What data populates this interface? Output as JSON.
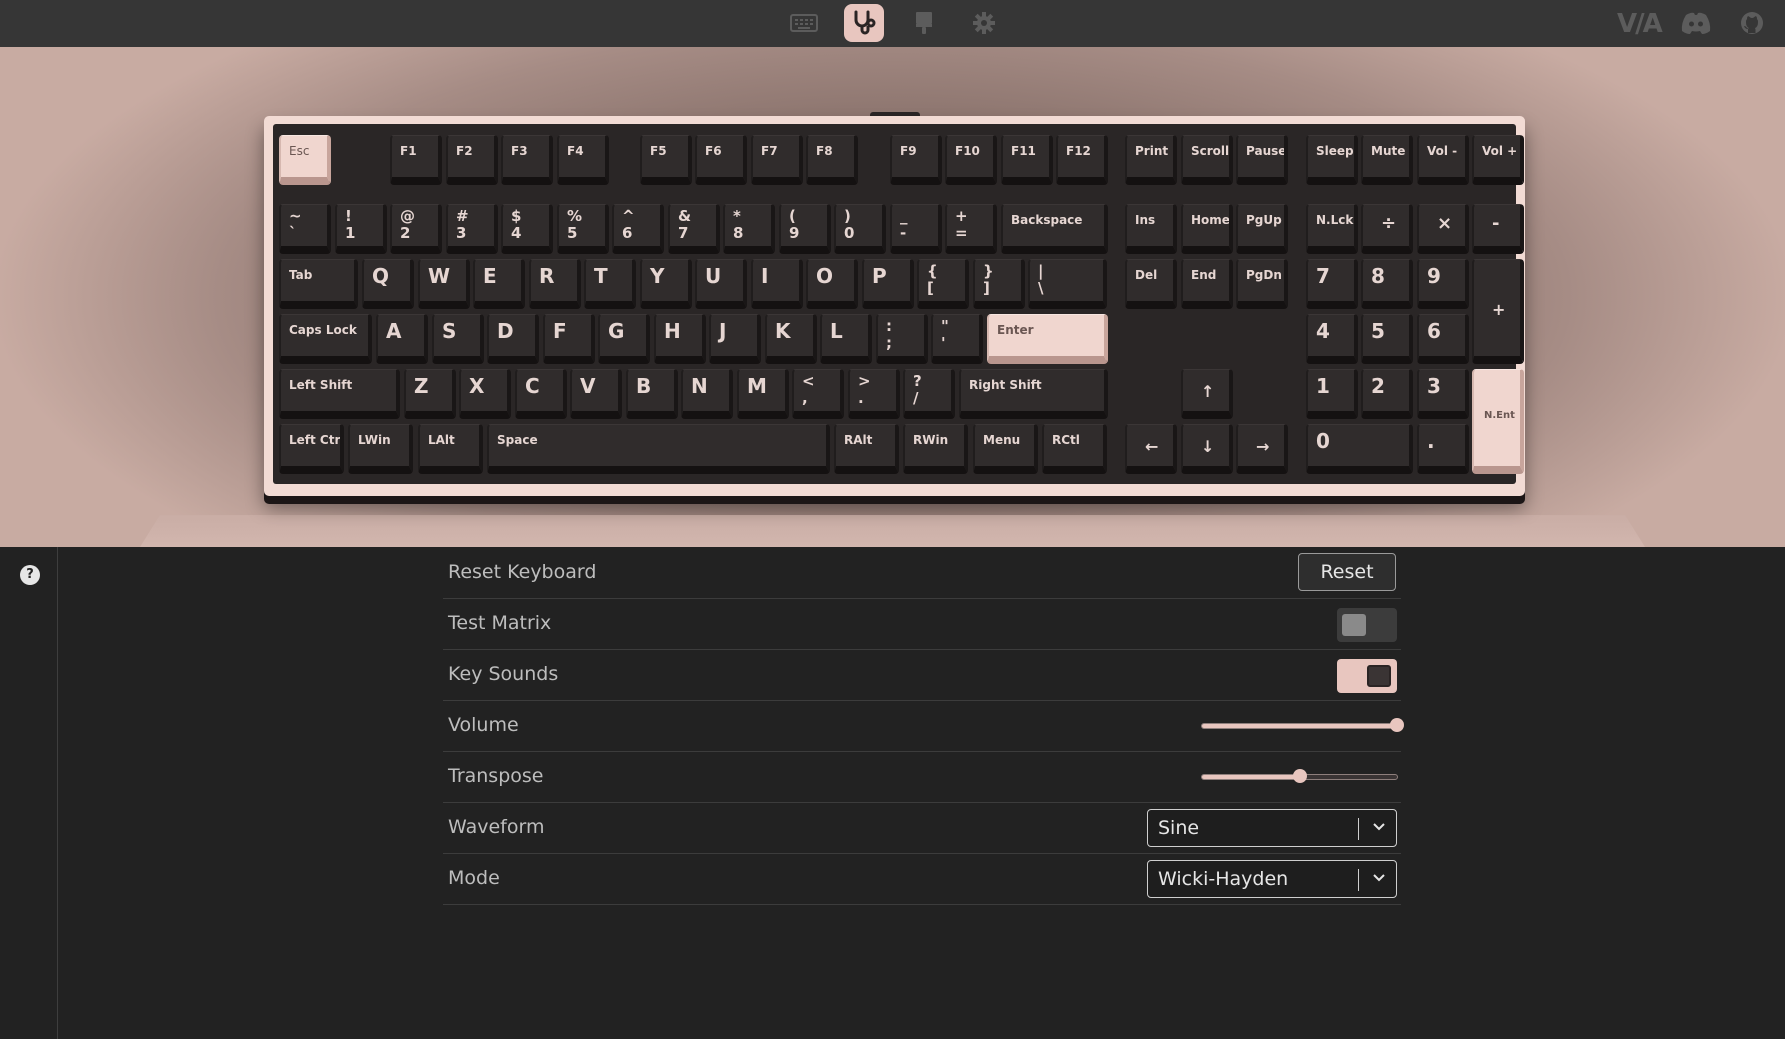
{
  "nav": {
    "icons": [
      "keyboard-icon",
      "stethoscope-icon",
      "design-icon",
      "gear-icon"
    ],
    "active": "stethoscope-icon",
    "logo_text": "V/A",
    "right_icons": [
      "via-logo",
      "discord-icon",
      "github-icon"
    ]
  },
  "colors": {
    "accent": "#e8c6bf",
    "background": "#222222",
    "topbar": "#363636",
    "keycap": "#302c2c"
  },
  "keyboard": {
    "keys": [
      {
        "label": "Esc",
        "pink": true
      },
      {
        "label": "F1"
      },
      {
        "label": "F2"
      },
      {
        "label": "F3"
      },
      {
        "label": "F4"
      },
      {
        "label": "F5"
      },
      {
        "label": "F6"
      },
      {
        "label": "F7"
      },
      {
        "label": "F8"
      },
      {
        "label": "F9"
      },
      {
        "label": "F10"
      },
      {
        "label": "F11"
      },
      {
        "label": "F12"
      },
      {
        "label": "Print"
      },
      {
        "label": "Scroll"
      },
      {
        "label": "Pause"
      },
      {
        "label": "Sleep"
      },
      {
        "label": "Mute"
      },
      {
        "label": "Vol -"
      },
      {
        "label": "Vol +"
      },
      {
        "top": "~",
        "bottom": "`"
      },
      {
        "top": "!",
        "bottom": "1"
      },
      {
        "top": "@",
        "bottom": "2"
      },
      {
        "top": "#",
        "bottom": "3"
      },
      {
        "top": "$",
        "bottom": "4"
      },
      {
        "top": "%",
        "bottom": "5"
      },
      {
        "top": "^",
        "bottom": "6"
      },
      {
        "top": "&",
        "bottom": "7"
      },
      {
        "top": "*",
        "bottom": "8"
      },
      {
        "top": "(",
        "bottom": "9"
      },
      {
        "top": ")",
        "bottom": "0"
      },
      {
        "top": "_",
        "bottom": "-"
      },
      {
        "top": "+",
        "bottom": "="
      },
      {
        "label": "Backspace"
      },
      {
        "label": "Ins"
      },
      {
        "label": "Home"
      },
      {
        "label": "PgUp"
      },
      {
        "label": "N.Lck"
      },
      {
        "label": "÷"
      },
      {
        "label": "×"
      },
      {
        "label": "-"
      },
      {
        "label": "Tab"
      },
      {
        "big": "Q"
      },
      {
        "big": "W"
      },
      {
        "big": "E"
      },
      {
        "big": "R"
      },
      {
        "big": "T"
      },
      {
        "big": "Y"
      },
      {
        "big": "U"
      },
      {
        "big": "I"
      },
      {
        "big": "O"
      },
      {
        "big": "P"
      },
      {
        "top": "{",
        "bottom": "["
      },
      {
        "top": "}",
        "bottom": "]"
      },
      {
        "top": "|",
        "bottom": "\\"
      },
      {
        "label": "Del"
      },
      {
        "label": "End"
      },
      {
        "label": "PgDn"
      },
      {
        "big": "7"
      },
      {
        "big": "8"
      },
      {
        "big": "9"
      },
      {
        "label": "+"
      },
      {
        "label": "Caps Lock"
      },
      {
        "big": "A"
      },
      {
        "big": "S"
      },
      {
        "big": "D"
      },
      {
        "big": "F"
      },
      {
        "big": "G"
      },
      {
        "big": "H"
      },
      {
        "big": "J"
      },
      {
        "big": "K"
      },
      {
        "big": "L"
      },
      {
        "top": ":",
        "bottom": ";"
      },
      {
        "top": "\"",
        "bottom": "'"
      },
      {
        "label": "Enter",
        "pink": true
      },
      {
        "big": "4"
      },
      {
        "big": "5"
      },
      {
        "big": "6"
      },
      {
        "label": "Left Shift"
      },
      {
        "big": "Z"
      },
      {
        "big": "X"
      },
      {
        "big": "C"
      },
      {
        "big": "V"
      },
      {
        "big": "B"
      },
      {
        "big": "N"
      },
      {
        "big": "M"
      },
      {
        "top": "<",
        "bottom": ","
      },
      {
        "top": ">",
        "bottom": "."
      },
      {
        "top": "?",
        "bottom": "/"
      },
      {
        "label": "Right Shift"
      },
      {
        "label": "↑"
      },
      {
        "big": "1"
      },
      {
        "big": "2"
      },
      {
        "big": "3"
      },
      {
        "label": "N.Ent",
        "pink": true
      },
      {
        "label": "Left Ctrl"
      },
      {
        "label": "LWin"
      },
      {
        "label": "LAlt"
      },
      {
        "label": "Space"
      },
      {
        "label": "RAlt"
      },
      {
        "label": "RWin"
      },
      {
        "label": "Menu"
      },
      {
        "label": "RCtl"
      },
      {
        "label": "←"
      },
      {
        "label": "↓"
      },
      {
        "label": "→"
      },
      {
        "big": "0"
      },
      {
        "big": "."
      }
    ]
  },
  "settings": {
    "reset_keyboard": {
      "label": "Reset Keyboard",
      "button": "Reset"
    },
    "test_matrix": {
      "label": "Test Matrix",
      "on": false
    },
    "key_sounds": {
      "label": "Key Sounds",
      "on": true
    },
    "volume": {
      "label": "Volume",
      "value": 1.0
    },
    "transpose": {
      "label": "Transpose",
      "value": 0.5
    },
    "waveform": {
      "label": "Waveform",
      "value": "Sine"
    },
    "mode": {
      "label": "Mode",
      "value": "Wicki-Hayden"
    }
  },
  "help": {
    "glyph": "?"
  }
}
